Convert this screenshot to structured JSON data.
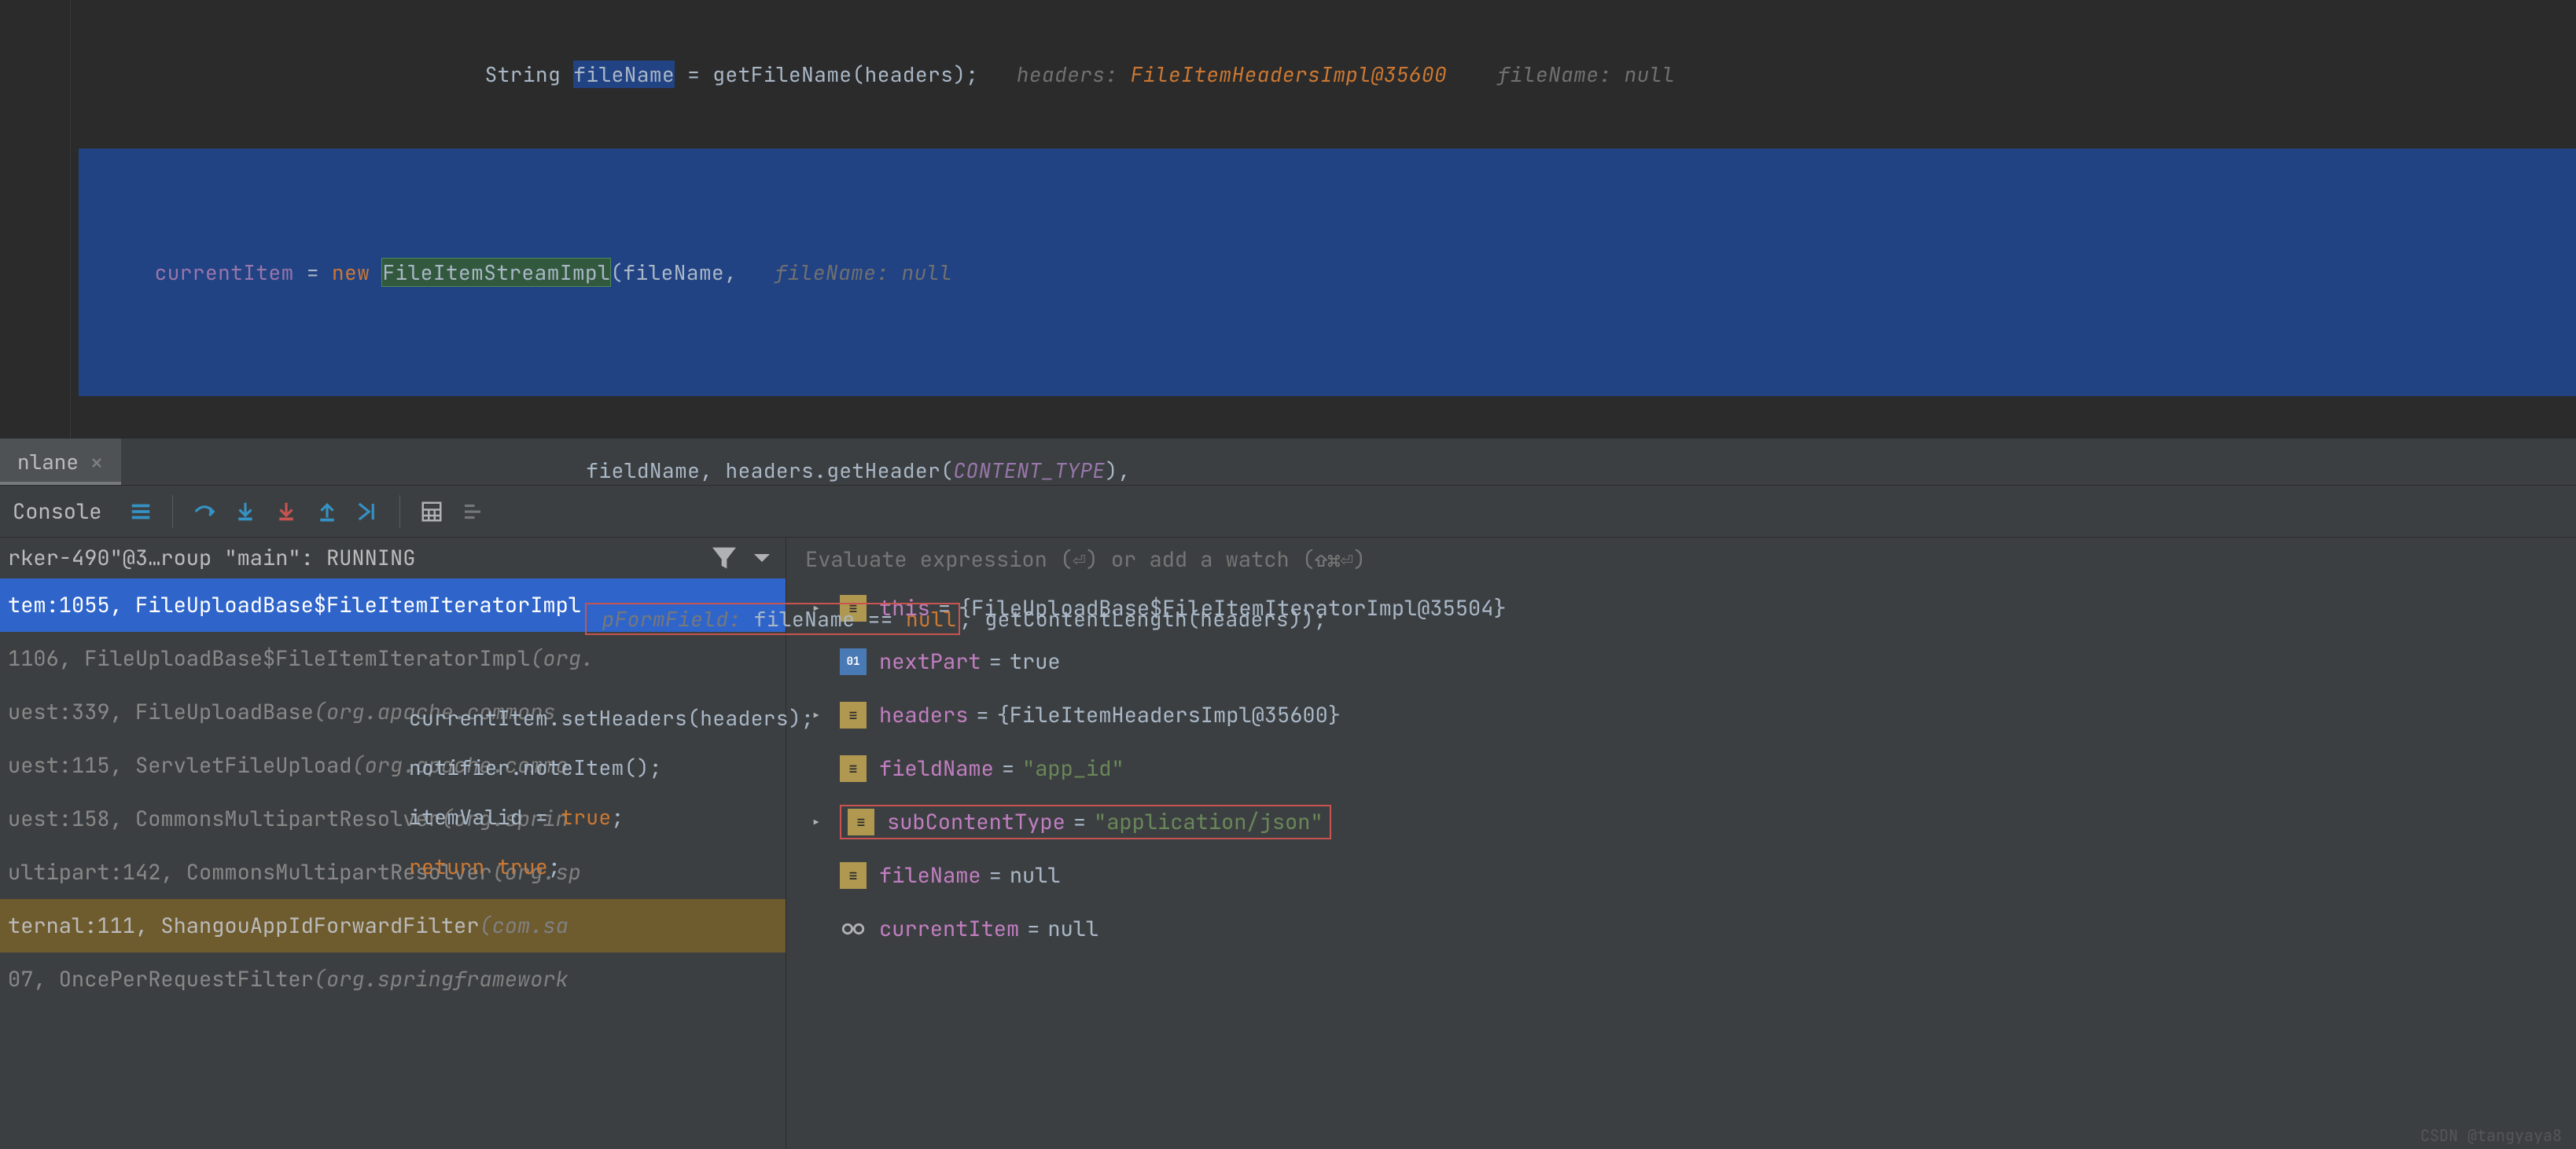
{
  "editor": {
    "lines": {
      "l1": {
        "prefix": "String ",
        "var": "fileName",
        "assign": " = getFileName(headers);",
        "hint1_label": "   headers: ",
        "hint1_val": "FileItemHeadersImpl@35600",
        "hint2_label": "    fileName: ",
        "hint2_val": "null"
      },
      "l2": {
        "lhs": "currentItem",
        "assign": " = ",
        "newkw": "new ",
        "type": "FileItemStreamImpl",
        "args1": "(fileName,",
        "hint_label": "   fileName: ",
        "hint_val": "null"
      },
      "l3": {
        "indent": "        ",
        "part1": "fieldName, headers.getHeader(",
        "const": "CONTENT_TYPE",
        "part2": "),"
      },
      "l4": {
        "indent": "        ",
        "param_hint": " pFormField: ",
        "expr1": "fileName == ",
        "nullkw": "null",
        "rest": ", getContentLength(headers));"
      },
      "l5": "currentItem.setHeaders(headers);",
      "l6": "notifier.noteItem();",
      "l7_lhs": "itemValid",
      "l7_rest": " = ",
      "l7_true": "true",
      "l7_semi": ";",
      "l8_ret": "return ",
      "l8_true": "true",
      "l8_semi": ";"
    }
  },
  "tab": {
    "name": "nlane",
    "close": "×"
  },
  "toolbar": {
    "console": "Console"
  },
  "frames": {
    "thread": "rker-490\"@3…roup \"main\": RUNNING",
    "items": [
      {
        "main": "tem:1055, FileUploadBase$FileItemIteratorImpl",
        "meta": "",
        "selected": true
      },
      {
        "main": "1106, FileUploadBase$FileItemIteratorImpl ",
        "meta": "(org.",
        "dim": true
      },
      {
        "main": "uest:339, FileUploadBase ",
        "meta": "(org.apache.commons",
        "dim": true
      },
      {
        "main": "uest:115, ServletFileUpload ",
        "meta": "(org.apache.commo",
        "dim": true
      },
      {
        "main": "uest:158, CommonsMultipartResolver ",
        "meta": "(org.sprin",
        "dim": true
      },
      {
        "main": "ultipart:142, CommonsMultipartResolver ",
        "meta": "(org.sp",
        "dim": true
      },
      {
        "main": "ternal:111, ShangouAppIdForwardFilter ",
        "meta": "(com.sa",
        "yellow": true
      },
      {
        "main": "07, OncePerRequestFilter ",
        "meta": "(org.springframework",
        "dim": true
      }
    ]
  },
  "vars": {
    "eval_placeholder": "Evaluate expression (⏎) or add a watch (⇧⌘⏎)",
    "items": [
      {
        "expand": true,
        "icon": "obj",
        "name": "this",
        "value": "{FileUploadBase$FileItemIteratorImpl@35504}"
      },
      {
        "expand": false,
        "icon": "prim",
        "name": "nextPart",
        "value": "true"
      },
      {
        "expand": true,
        "icon": "obj",
        "name": "headers",
        "value": "{FileItemHeadersImpl@35600}"
      },
      {
        "expand": false,
        "icon": "obj",
        "name": "fieldName",
        "value": "\"app_id\"",
        "string": true
      },
      {
        "expand": true,
        "icon": "obj",
        "name": "subContentType",
        "value": "\"application/json\"",
        "string": true,
        "redbox": true
      },
      {
        "expand": false,
        "icon": "obj",
        "name": "fileName",
        "value": "null"
      },
      {
        "expand": false,
        "icon": "watch",
        "name": "currentItem",
        "value": "null"
      }
    ]
  },
  "watermark": "CSDN @tangyaya8"
}
